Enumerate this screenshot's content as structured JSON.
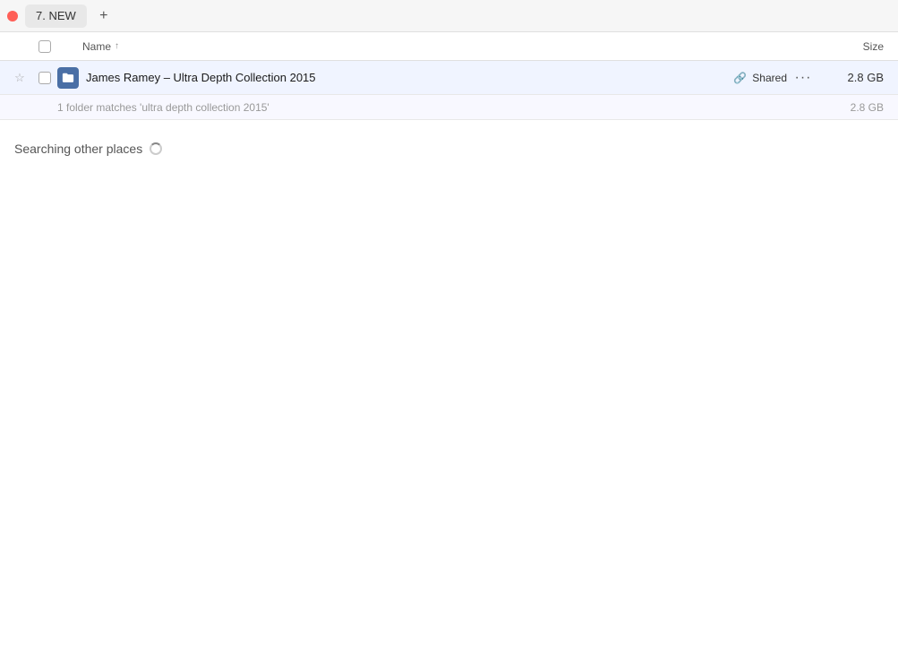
{
  "topbar": {
    "tab_label": "7. NEW",
    "add_tab_icon": "+"
  },
  "columns": {
    "name_label": "Name",
    "name_sort_arrow": "↑",
    "size_label": "Size"
  },
  "file_row": {
    "name": "James Ramey – Ultra Depth Collection 2015",
    "shared_label": "Shared",
    "size": "2.8 GB",
    "more_icon": "···"
  },
  "sub_info": {
    "text": "1 folder matches 'ultra depth collection 2015'",
    "size": "2.8 GB"
  },
  "searching": {
    "label": "Searching other places"
  },
  "colors": {
    "selected_row_bg": "#eef2ff",
    "file_icon_bg": "#4a6fa5"
  }
}
